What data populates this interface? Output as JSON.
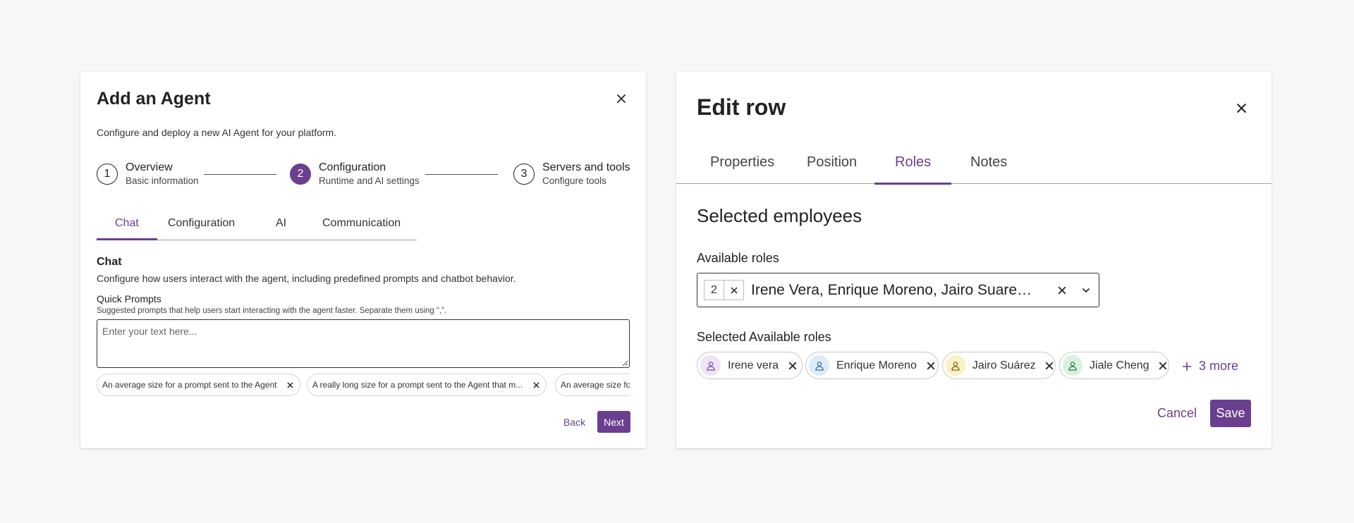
{
  "agent_dialog": {
    "title": "Add an Agent",
    "description": "Configure and deploy a new AI Agent for your platform.",
    "steps": [
      {
        "number": "1",
        "title": "Overview",
        "subtitle": "Basic information",
        "state": "pending"
      },
      {
        "number": "2",
        "title": "Configuration",
        "subtitle": "Runtime and AI settings",
        "state": "active"
      },
      {
        "number": "3",
        "title": "Servers and tools",
        "subtitle": "Configure tools",
        "state": "pending"
      }
    ],
    "tabs": [
      {
        "label": "Chat",
        "active": true
      },
      {
        "label": "Configuration",
        "active": false
      },
      {
        "label": "AI",
        "active": false
      },
      {
        "label": "Communication",
        "active": false
      }
    ],
    "section_title": "Chat",
    "section_description": "Configure how users interact with the agent, including predefined prompts and chatbot behavior.",
    "quick_prompts": {
      "label": "Quick Prompts",
      "hint": "Suggested prompts that help users start interacting with the agent faster. Separate them using “,”.",
      "placeholder": "Enter your text here...",
      "value": "",
      "chips": [
        "An average size for a prompt sent to the Agent",
        "A really long size for a prompt sent to the Agent that m...",
        "An average size for a prompt sent to the Agent"
      ]
    },
    "back_label": "Back",
    "next_label": "Next"
  },
  "edit_dialog": {
    "title": "Edit row",
    "tabs": [
      {
        "label": "Properties",
        "active": false
      },
      {
        "label": "Position",
        "active": false
      },
      {
        "label": "Roles",
        "active": true
      },
      {
        "label": "Notes",
        "active": false
      }
    ],
    "section_title": "Selected employees",
    "available_roles": {
      "label": "Available roles",
      "count": "2",
      "value": "Irene Vera, Enrique Moreno, Jairo Suarez, Jiale Cheng"
    },
    "selected_label": "Selected Available roles",
    "employees": [
      {
        "name": "Irene vera",
        "avatar_bg": "#efe3f6",
        "avatar_fg": "#7a4d9a"
      },
      {
        "name": "Enrique Moreno",
        "avatar_bg": "#dcecf8",
        "avatar_fg": "#3d6f95"
      },
      {
        "name": "Jairo Suárez",
        "avatar_bg": "#fbf0c2",
        "avatar_fg": "#7a6420"
      },
      {
        "name": "Jiale Cheng",
        "avatar_bg": "#d8f2dd",
        "avatar_fg": "#2f7a45"
      }
    ],
    "more_label": "3 more",
    "cancel_label": "Cancel",
    "save_label": "Save"
  },
  "colors": {
    "accent": "#6b3f8f",
    "background": "#f7f7f8",
    "card": "#ffffff"
  },
  "icons": {
    "close": "close-icon",
    "clear": "clear-icon",
    "caret": "chevron-down-icon",
    "person": "person-icon",
    "plus": "plus-icon"
  }
}
